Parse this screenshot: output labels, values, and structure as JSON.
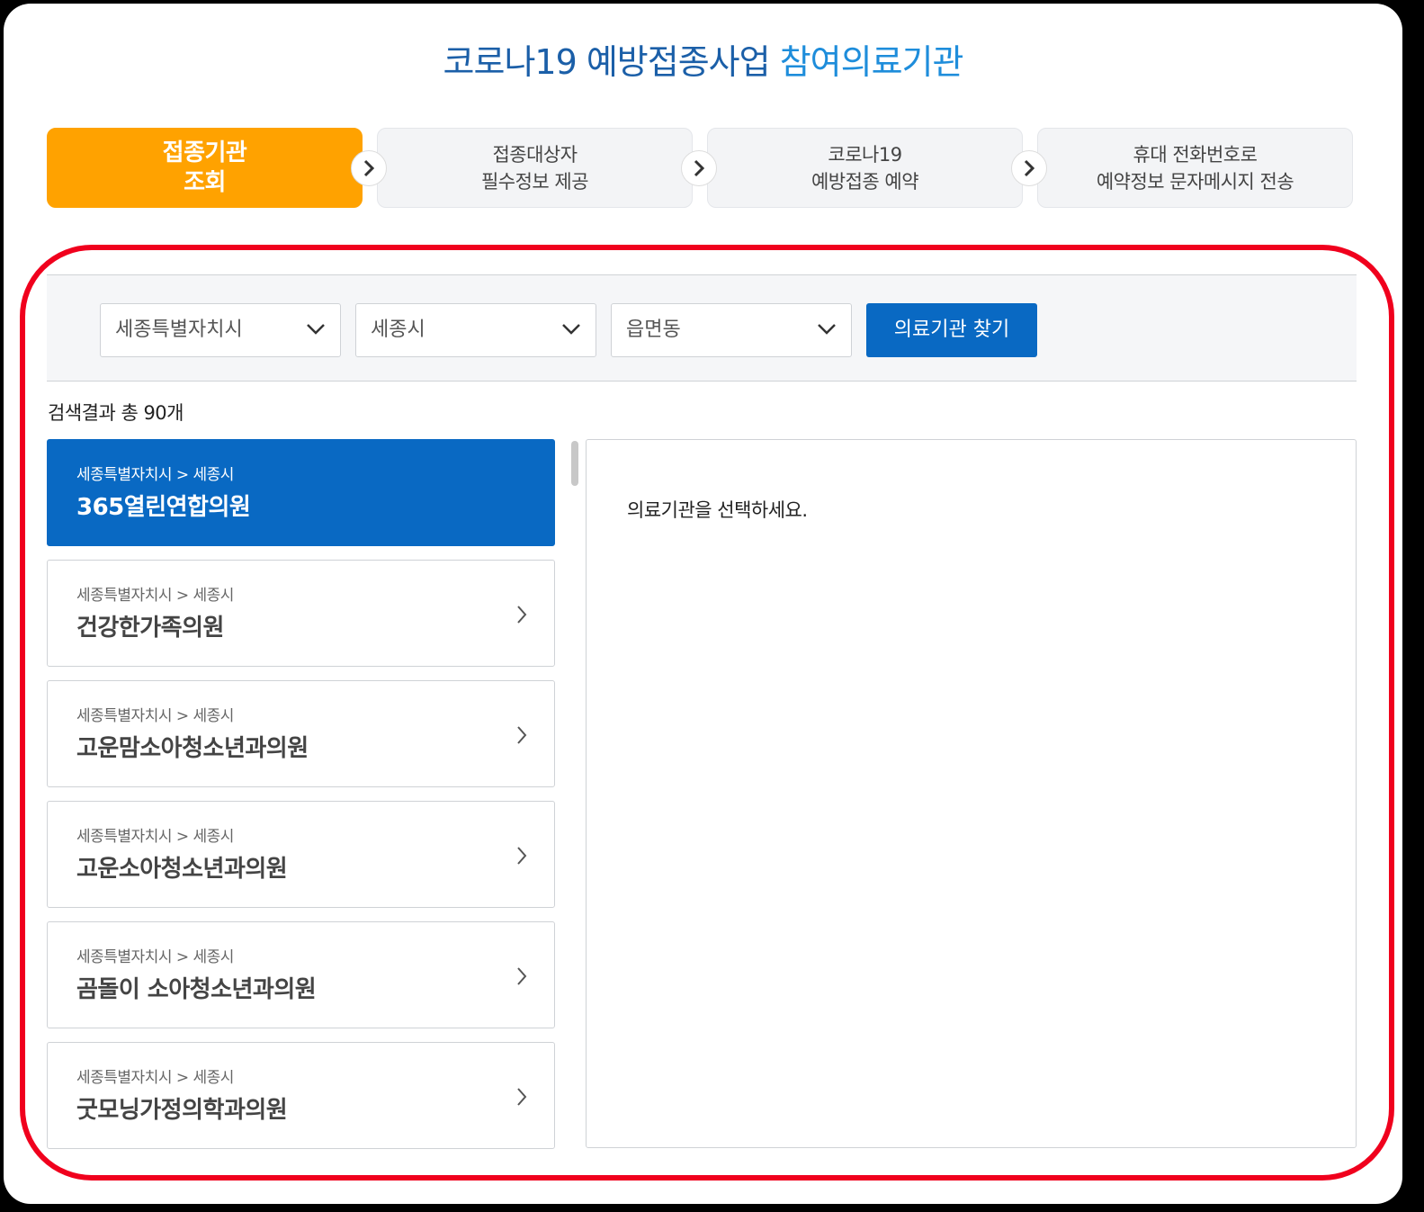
{
  "header": {
    "title_main": "코로나19 예방접종사업",
    "title_highlight": "참여의료기관"
  },
  "steps": [
    {
      "line1": "접종기관",
      "line2": "조회",
      "active": true
    },
    {
      "line1": "접종대상자",
      "line2": "필수정보 제공",
      "active": false
    },
    {
      "line1": "코로나19",
      "line2": "예방접종 예약",
      "active": false
    },
    {
      "line1": "휴대 전화번호로",
      "line2": "예약정보 문자메시지 전송",
      "active": false
    }
  ],
  "search": {
    "sido": "세종특별자치시",
    "sigungu": "세종시",
    "dong": "읍면동",
    "button_label": "의료기관 찾기"
  },
  "results": {
    "count_label": "검색결과 총 90개",
    "items": [
      {
        "region": "세종특별자치시 > 세종시",
        "name": "365열린연합의원",
        "selected": true
      },
      {
        "region": "세종특별자치시 > 세종시",
        "name": "건강한가족의원",
        "selected": false
      },
      {
        "region": "세종특별자치시 > 세종시",
        "name": "고운맘소아청소년과의원",
        "selected": false
      },
      {
        "region": "세종특별자치시 > 세종시",
        "name": "고운소아청소년과의원",
        "selected": false
      },
      {
        "region": "세종특별자치시 > 세종시",
        "name": "곰돌이 소아청소년과의원",
        "selected": false
      },
      {
        "region": "세종특별자치시 > 세종시",
        "name": "굿모닝가정의학과의원",
        "selected": false
      }
    ]
  },
  "detail": {
    "placeholder": "의료기관을 선택하세요."
  },
  "colors": {
    "active_step": "#ffa200",
    "primary": "#0969c3",
    "highlight_border": "#f0001d"
  }
}
